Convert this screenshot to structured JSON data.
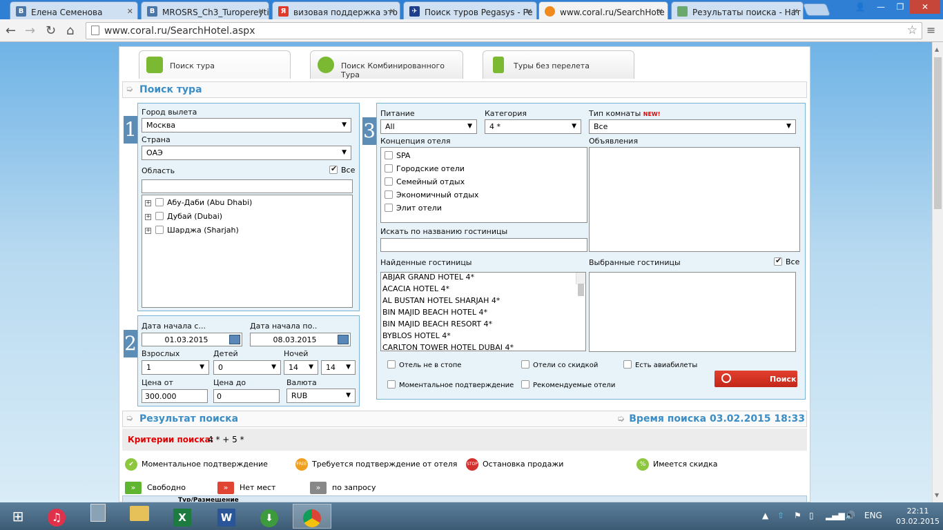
{
  "browser": {
    "tabs": [
      {
        "title": "Елена Семенова",
        "icon": "vk-icon",
        "color": "#4a76a8"
      },
      {
        "title": "MROSRS_Ch3_Turopereyti",
        "icon": "vk-icon",
        "color": "#4a76a8"
      },
      {
        "title": "визовая поддержка это – ",
        "icon": "yandex-icon",
        "color": "#e03a2c"
      },
      {
        "title": "Поиск туров Pegasys - Pe",
        "icon": "pegas-icon",
        "color": "#1d3e8a"
      },
      {
        "title": "www.coral.ru/SearchHote",
        "icon": "coral-icon",
        "color": "#f08a1c"
      },
      {
        "title": "Результаты поиска - Нат",
        "icon": "map-icon",
        "color": "#6aa86e"
      }
    ],
    "active_tab": 4,
    "url": "www.coral.ru/SearchHotel.aspx"
  },
  "search_tabs": [
    "Поиск тура",
    "Поиск Комбинированного Тура",
    "Туры без перелета"
  ],
  "section_title": "Поиск тура",
  "panel1": {
    "number": "1",
    "departure_label": "Город вылета",
    "departure_value": "Москва",
    "country_label": "Страна",
    "country_value": "ОАЭ",
    "region_label": "Область",
    "all_label": "Все",
    "regions": [
      "Абу-Даби (Abu Dhabi)",
      "Дубай (Dubai)",
      "Шарджа (Sharjah)"
    ]
  },
  "panel2": {
    "number": "2",
    "date_from_label": "Дата начала с...",
    "date_from_value": "01.03.2015",
    "date_to_label": "Дата начала по..",
    "date_to_value": "08.03.2015",
    "adults_label": "Взрослых",
    "adults_value": "1",
    "children_label": "Детей",
    "children_value": "0",
    "nights_label": "Ночей",
    "nights_from": "14",
    "nights_to": "14",
    "price_from_label": "Цена от",
    "price_from_value": "300.000",
    "price_to_label": "Цена до",
    "price_to_value": "0",
    "currency_label": "Валюта",
    "currency_value": "RUB"
  },
  "panel3": {
    "number": "3",
    "meal_label": "Питание",
    "meal_value": "All",
    "category_label": "Категория",
    "category_value": "4 *",
    "room_label": "Тип комнаты",
    "room_new": "NEW!",
    "room_value": "Все",
    "concept_label": "Концепция отеля",
    "concepts": [
      "SPA",
      "Городские отели",
      "Семейный отдых",
      "Экономичный отдых",
      "Элит отели"
    ],
    "announcements_label": "Объявления",
    "hotel_search_label": "Искать по названию гостиницы",
    "found_label": "Найденные гостиницы",
    "selected_label": "Выбранные гостиницы",
    "all_label": "Все",
    "hotels": [
      "ABJAR GRAND HOTEL 4*",
      "ACACIA HOTEL 4*",
      "AL BUSTAN HOTEL SHARJAH 4*",
      "BIN MAJID BEACH HOTEL 4*",
      "BIN MAJID BEACH RESORT 4*",
      "BYBLOS HOTEL 4*",
      "CARLTON TOWER HOTEL DUBAI 4*"
    ],
    "filters": [
      "Отель не в стопе",
      "Отели со скидкой",
      "Есть авиабилеты",
      "Моментальное подтверждение",
      "Рекомендуемые отели"
    ],
    "search_button": "Поиск"
  },
  "results": {
    "title": "Результат поиска",
    "time_label": "Время поиска 03.02.2015 18:33",
    "criteria_label": "Критерии поиска:",
    "criteria_value": "4 * + 5 *",
    "legend": [
      "Моментальное подтверждение",
      "Требуется подтверждение от отеля",
      "Остановка продажи",
      "Имеется скидка"
    ],
    "availability": [
      "Свободно",
      "Нет мест",
      "по запросу"
    ],
    "table_header_partial": "Тур/Размещение"
  },
  "taskbar": {
    "lang": "ENG",
    "time": "22:11",
    "date": "03.02.2015"
  },
  "colors": {
    "accent": "#3a8dc6",
    "panel_bg": "#e7f3f9",
    "search_btn": "#d2321f",
    "criteria": "#e00000"
  }
}
